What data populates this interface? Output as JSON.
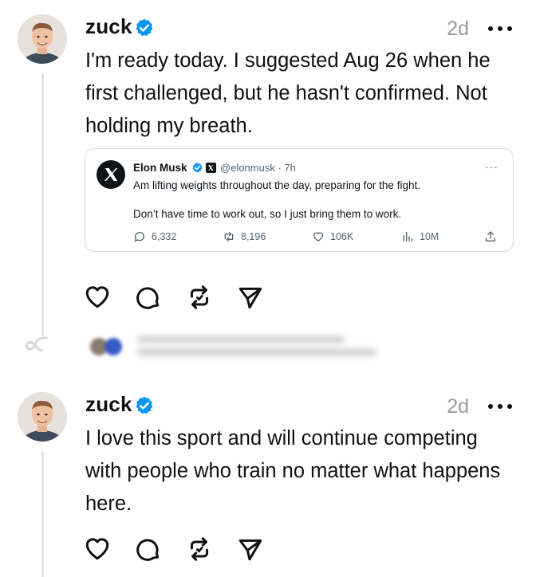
{
  "posts": [
    {
      "username": "zuck",
      "time": "2d",
      "text": "I'm ready today. I suggested Aug 26 when he first challenged, but he hasn't confirmed. Not holding my breath.",
      "quoted": {
        "name": "Elon Musk",
        "handle": "@elonmusk · 7h",
        "line1": "Am lifting weights throughout the day, preparing for the fight.",
        "line2": "Don’t have time to work out, so I just bring them to work.",
        "replies": "6,332",
        "reposts": "8,196",
        "likes": "106K",
        "views": "10M"
      }
    },
    {
      "username": "zuck",
      "time": "2d",
      "text": "I love this sport and will continue competing with people who train no matter what happens here."
    }
  ],
  "colors": {
    "verified": "#0095f6",
    "muted": "#9a9a9a",
    "card_border": "#cfd9de",
    "thread_line": "#e3e3e3"
  },
  "icons": [
    "avatar",
    "verified-icon",
    "more-icon",
    "heart-icon",
    "comment-icon",
    "repost-icon",
    "share-icon",
    "x-logo-icon",
    "loop-icon"
  ]
}
